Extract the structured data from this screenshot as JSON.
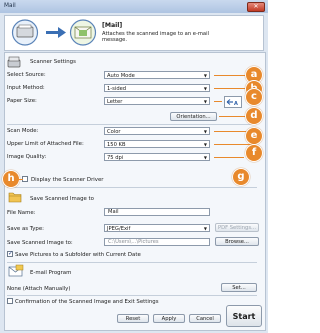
{
  "window": {
    "title": "Mail",
    "close_glyph": "✕"
  },
  "header": {
    "title": "[Mail]",
    "description": "Attaches the scanned image to an e-mail message."
  },
  "scanner_settings": {
    "section_label": "Scanner Settings",
    "select_source": {
      "label": "Select Source:",
      "value": "Auto Mode"
    },
    "input_method": {
      "label": "Input Method:",
      "value": "1-sided"
    },
    "paper_size": {
      "label": "Paper Size:",
      "value": "Letter"
    },
    "orientation_button": "Orientation...",
    "scan_mode": {
      "label": "Scan Mode:",
      "value": "Color"
    },
    "upper_limit": {
      "label": "Upper Limit of Attached File:",
      "value": "150 KB"
    },
    "image_quality": {
      "label": "Image Quality:",
      "value": "75 dpi"
    },
    "display_driver": {
      "label": "Display the Scanner Driver",
      "checked": false
    }
  },
  "save_section": {
    "section_label": "Save Scanned Image to",
    "file_name": {
      "label": "File Name:",
      "value": "Mail"
    },
    "save_as_type": {
      "label": "Save as Type:",
      "value": "JPEG/Exif"
    },
    "pdf_settings_button": "PDF Settings...",
    "save_to": {
      "label": "Save Scanned Image to:",
      "value": "C:\\Users\\...\\Pictures"
    },
    "browse_button": "Browse...",
    "subfolder": {
      "label": "Save Pictures to a Subfolder with Current Date",
      "checked": true
    }
  },
  "email_section": {
    "section_label": "E-mail Program",
    "program_value": "None (Attach Manually)",
    "set_button": "Set..."
  },
  "footer": {
    "confirm": {
      "label": "Confirmation of the Scanned Image and Exit Settings",
      "checked": false
    },
    "reset_button": "Reset",
    "apply_button": "Apply",
    "cancel_button": "Cancel",
    "start_button": "Start"
  },
  "callouts": {
    "a": "a",
    "b": "b",
    "c": "c",
    "d": "d",
    "e": "e",
    "f": "f",
    "g": "g",
    "h": "h"
  },
  "colors": {
    "accent": "#e8892c",
    "window_bg": "#dde6f1",
    "title_bar": "#aec4e2"
  }
}
